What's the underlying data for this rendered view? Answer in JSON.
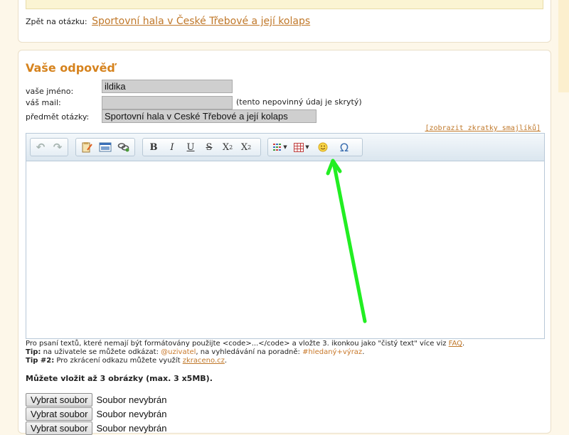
{
  "back": {
    "label": "Zpět na otázku:",
    "link": "Sportovní hala v České Třebové a její kolaps"
  },
  "answer": {
    "title": "Vaše odpověď",
    "name_label": "vaše jméno:",
    "name_value": "ildika",
    "mail_label": "váš mail:",
    "mail_value": "",
    "mail_hint": "(tento nepovinný údaj je skrytý)",
    "subject_label": "předmět otázky:",
    "subject_value": "Sportovní hala v Ceské Třebové a její kolaps",
    "smiley_link": "[zobrazit zkratky smajlíků]"
  },
  "toolbar": {
    "bold": "B",
    "italic": "I",
    "underline": "U",
    "strike": "S",
    "subscript": "X",
    "subscript_mark": "2",
    "superscript": "X",
    "superscript_mark": "2",
    "omega": "Ω"
  },
  "notes": {
    "line1_pre": "Pro psaní textů, které nemají být formátovány použijte <code>...</code> a vložte 3. ikonkou jako \"čistý text\" více viz ",
    "line1_link": "FAQ",
    "line1_post": ".",
    "tip_label": "Tip:",
    "tip_pre": " na uživatele se můžete odkázat: ",
    "tip_user": "@uzivatel",
    "tip_mid": ", na vyhledávání na poradně: ",
    "tip_tag": "#hledaný+výraz",
    "tip_post": ".",
    "tip2_label": "Tip #2:",
    "tip2_pre": " Pro zkrácení odkazu můžete využít ",
    "tip2_link": "zkraceno.cz",
    "tip2_post": "."
  },
  "upload": {
    "title": "Můžete vložit až 3 obrázky (max. 3 x5MB).",
    "button": "Vybrat soubor",
    "status": "Soubor nevybrán"
  },
  "colors": {
    "accent": "#d6831e",
    "link": "#c0782a",
    "highlight": "#22ee22"
  }
}
